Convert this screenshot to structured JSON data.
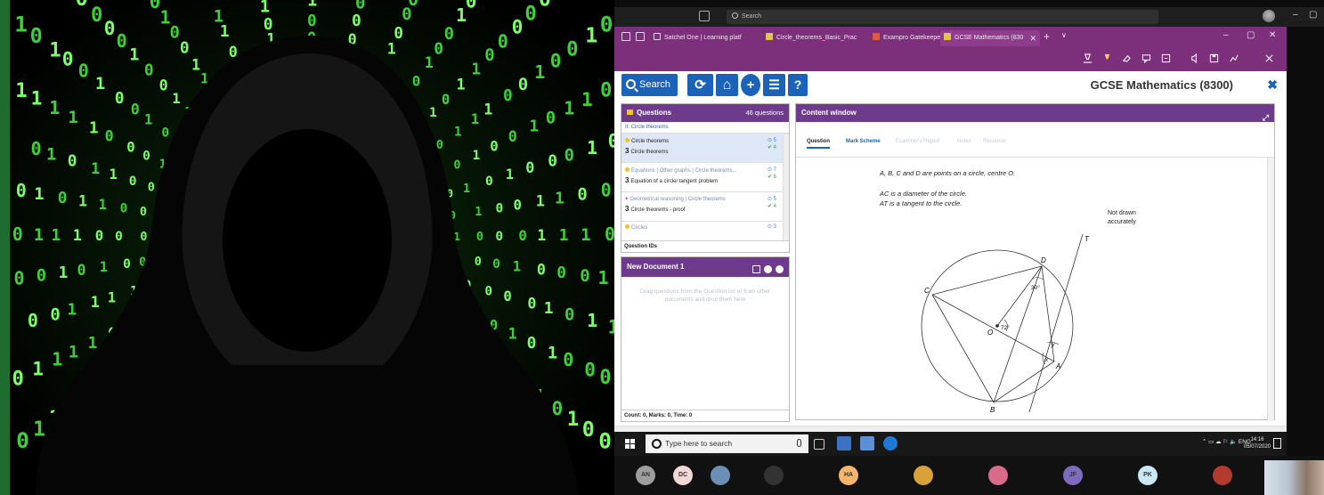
{
  "zoom": {
    "search_placeholder": "Search"
  },
  "browser": {
    "tabs": [
      {
        "label": "Satchel One | Learning platf"
      },
      {
        "label": "Circle_theorems_Basic_Prac"
      },
      {
        "label": "Exampro Gatekeeper"
      },
      {
        "label": "GCSE Mathematics (830"
      }
    ],
    "new_tab": "+",
    "tab_menu": "∨",
    "minimize": "–",
    "maximize": "▢",
    "close": "✕"
  },
  "app": {
    "search_label": "Search",
    "title": "GCSE Mathematics (8300)",
    "close_glyph": "✖",
    "toolbar_glyphs": {
      "refresh": "⟳",
      "home": "⌂",
      "add": "+",
      "list": "☰",
      "help": "?"
    }
  },
  "questions_panel": {
    "title": "Questions",
    "count": "46 questions",
    "filter": "II: Circle theorems",
    "items": [
      {
        "topic": "Circle theorems",
        "marks": "3",
        "subtopic": "Circle theorems",
        "stat1": "⊙ 5",
        "stat2": "✔ 4",
        "dot_color": "#f2c12e"
      },
      {
        "topic": "Equations | Other graphs | Circle theorems...",
        "marks": "3",
        "subtopic": "Equation of a circle/ tangent problem",
        "stat1": "⊙ 7",
        "stat2": "✔ 6",
        "dot_color": "#f2c12e"
      },
      {
        "topic": "Geometrical reasoning | Circle theorems",
        "marks": "3",
        "subtopic": "Circle theorems - proof",
        "stat1": "⊙ 5",
        "stat2": "✔ 4",
        "dot_color": "#c2185b"
      },
      {
        "topic": "Circles",
        "marks": "",
        "subtopic": "",
        "stat1": "⊙ 3",
        "stat2": "",
        "dot_color": "#f2c12e"
      }
    ],
    "footer": "Question IDs"
  },
  "document_panel": {
    "title": "New Document 1",
    "hint": "Drag questions from the Question list or from other documents and drop them here",
    "footer": "Count: 0, Marks: 0, Time: 0"
  },
  "content_window": {
    "title": "Content window",
    "tabs": [
      "Question",
      "Mark Scheme",
      "Examiner's Report",
      "Notes",
      "Resource"
    ],
    "q_line1": "A, B, C and D are points on a circle, centre O.",
    "q_line2": "AC is a diameter of the circle.",
    "q_line3": "AT is a tangent to the circle.",
    "not_drawn_1": "Not drawn",
    "not_drawn_2": "accurately",
    "diagram": {
      "label_C": "C",
      "label_D": "D",
      "label_T": "T",
      "label_O": "O",
      "label_A": "A",
      "label_B": "B",
      "label_x": "x",
      "label_y": "y",
      "angle_72": "72°",
      "angle_30": "30°"
    }
  },
  "taskbar": {
    "search_placeholder": "Type here to search",
    "tray_text": "ENG",
    "time": "14:16",
    "date": "05/07/2020"
  },
  "participants": [
    {
      "initials": "AN",
      "color": "#9e9e9e"
    },
    {
      "initials": "DC",
      "color": "#f2d7d7"
    },
    {
      "initials": "",
      "color": "#6b8fb5"
    },
    {
      "initials": "",
      "color": "#333333"
    },
    {
      "initials": "HA",
      "color": "#f5b56a"
    },
    {
      "initials": "",
      "color": "#d9a13a"
    },
    {
      "initials": "",
      "color": "#d86a8a"
    },
    {
      "initials": "JF",
      "color": "#7e6bbf"
    },
    {
      "initials": "PK",
      "color": "#c9e8f2"
    },
    {
      "initials": "",
      "color": "#b33a2f"
    }
  ]
}
